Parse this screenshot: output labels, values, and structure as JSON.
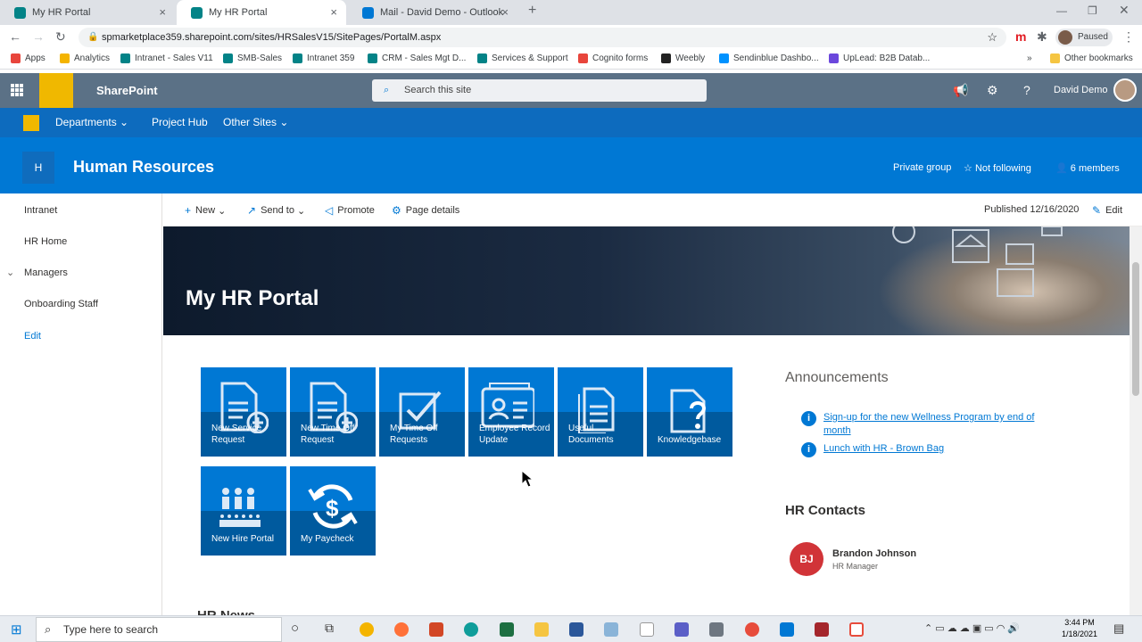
{
  "browser": {
    "tabs": [
      {
        "title": "My HR Portal",
        "color": "#038387"
      },
      {
        "title": "My HR Portal",
        "color": "#038387"
      },
      {
        "title": "Mail - David Demo - Outlook",
        "color": "#0078d4"
      }
    ],
    "new_tab": "+",
    "url": "spmarketplace359.sharepoint.com/sites/HRSalesV15/SitePages/PortalM.aspx",
    "profile_status": "Paused",
    "bookmarks": [
      {
        "label": "Apps",
        "color": "#e8453c"
      },
      {
        "label": "Analytics",
        "color": "#f4b400"
      },
      {
        "label": "Intranet - Sales V11",
        "color": "#038387"
      },
      {
        "label": "SMB-Sales",
        "color": "#038387"
      },
      {
        "label": "Intranet 359",
        "color": "#038387"
      },
      {
        "label": "CRM - Sales Mgt D...",
        "color": "#038387"
      },
      {
        "label": "Services & Support",
        "color": "#038387"
      },
      {
        "label": "Cognito forms",
        "color": "#e8453c"
      },
      {
        "label": "Weebly",
        "color": "#222222"
      },
      {
        "label": "Sendinblue Dashbo...",
        "color": "#0092ff"
      },
      {
        "label": "UpLead: B2B Datab...",
        "color": "#6b47dc"
      }
    ],
    "bookmarks_more": "»",
    "other_bookmarks": "Other bookmarks"
  },
  "suite": {
    "app_name": "SharePoint",
    "search_placeholder": "Search this site",
    "user_name": "David Demo"
  },
  "hub_nav": [
    "Departments",
    "Project Hub",
    "Other Sites"
  ],
  "site": {
    "icon_letter": "H",
    "title": "Human Resources",
    "privacy": "Private group",
    "follow": "Not following",
    "members": "6 members"
  },
  "left_nav": [
    {
      "label": "Intranet"
    },
    {
      "label": "HR Home"
    },
    {
      "label": "Managers"
    },
    {
      "label": "Onboarding Staff"
    },
    {
      "label": "Edit"
    }
  ],
  "command_bar": {
    "new": "New",
    "send_to": "Send to",
    "promote": "Promote",
    "page_details": "Page details",
    "published": "Published 12/16/2020",
    "edit": "Edit"
  },
  "banner": {
    "title": "My HR Portal"
  },
  "tiles": [
    {
      "label": "New Service Request",
      "icon": "document-add-icon"
    },
    {
      "label": "New Time Off Request",
      "icon": "document-add-icon"
    },
    {
      "label": "My Time Off Requests",
      "icon": "checkbox-icon"
    },
    {
      "label": "Employee Record Update",
      "icon": "contact-card-icon"
    },
    {
      "label": "Useful Documents",
      "icon": "documents-icon"
    },
    {
      "label": "Knowledgebase",
      "icon": "help-document-icon"
    },
    {
      "label": "New Hire Portal",
      "icon": "people-icon"
    },
    {
      "label": "My Paycheck",
      "icon": "dollar-refresh-icon"
    }
  ],
  "announcements": {
    "title": "Announcements",
    "items": [
      "Sign-up for the new Wellness Program by end of month",
      "Lunch with HR - Brown Bag"
    ]
  },
  "contacts": {
    "title": "HR Contacts",
    "initials": "BJ",
    "name": "Brandon Johnson",
    "role": "HR Manager"
  },
  "news_title": "HR News",
  "taskbar": {
    "search_placeholder": "Type here to search",
    "time": "3:44 PM",
    "date": "1/18/2021"
  }
}
